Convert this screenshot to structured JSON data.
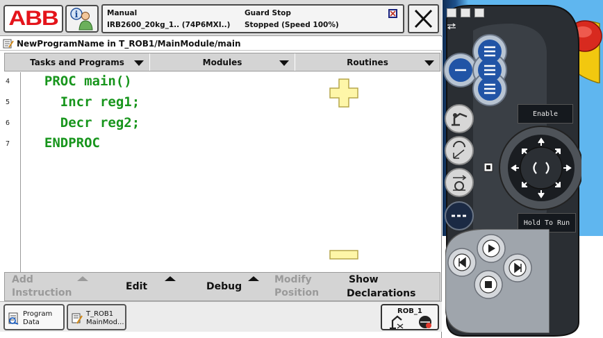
{
  "topbar": {
    "logo_text": "ABB",
    "status": {
      "mode": "Manual",
      "robot": "IRB2600_20kg_1.. (74P6MXI..)",
      "state": "Guard Stop",
      "speed": "Stopped (Speed 100%)"
    }
  },
  "path": {
    "text": "NewProgramName  in T_ROB1/MainModule/main"
  },
  "dropdowns": [
    {
      "label": "Tasks and Programs"
    },
    {
      "label": "Modules"
    },
    {
      "label": "Routines"
    }
  ],
  "editor": {
    "lines": [
      {
        "number": "4",
        "code": "  PROC main()"
      },
      {
        "number": "5",
        "code": "    Incr reg1;"
      },
      {
        "number": "6",
        "code": "    Decr reg2;"
      },
      {
        "number": "7",
        "code": "  ENDPROC"
      }
    ]
  },
  "bottombar": {
    "add_instruction": {
      "line1": "Add",
      "line2": "Instruction"
    },
    "edit": "Edit",
    "debug": "Debug",
    "modify_position": {
      "line1": "Modify",
      "line2": "Position"
    },
    "show_declarations": {
      "line1": "Show",
      "line2": "Declarations"
    }
  },
  "taskbar": {
    "program_data": {
      "line1": "Program",
      "line2": "Data"
    },
    "t_rob1": {
      "line1": "T_ROB1",
      "line2": "MainMod..."
    },
    "rob": "ROB_1"
  },
  "controller": {
    "enable_label": "Enable",
    "hold_label": "Hold To Run"
  },
  "colors": {
    "code_green": "#17951c",
    "abb_red": "#e4141b",
    "panel_blue": "#5fb6ef",
    "zoom_yellow": "#fef6a8"
  }
}
